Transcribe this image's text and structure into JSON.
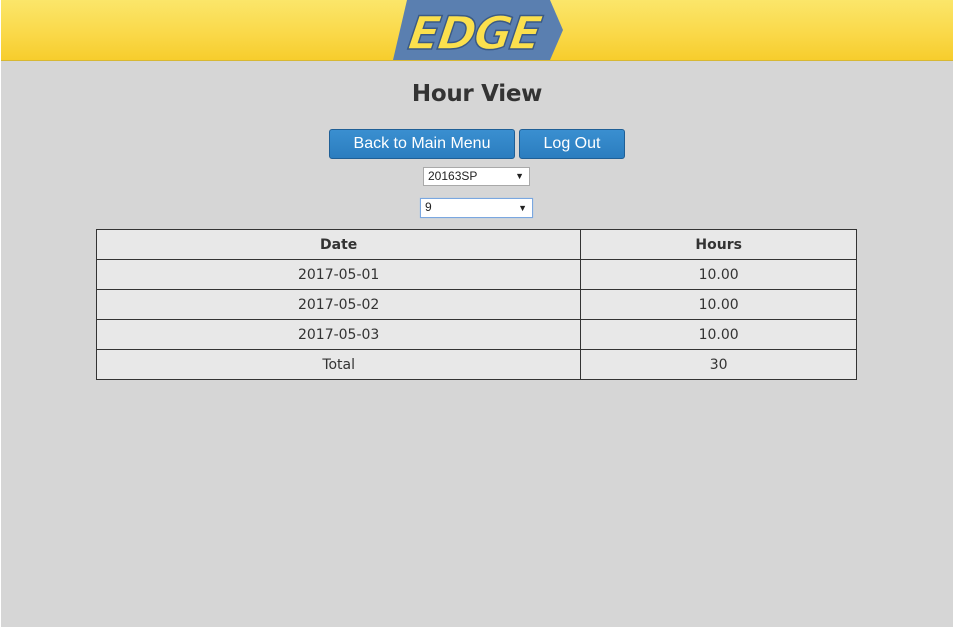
{
  "header": {
    "logo_text": "EDGE",
    "colors": {
      "banner_top": "#fbe66a",
      "banner_bottom": "#f7cd2c",
      "logo_fill": "#5a7fb0"
    }
  },
  "page": {
    "title": "Hour View",
    "background": "#d6d6d6"
  },
  "buttons": {
    "back_label": "Back to Main Menu",
    "logout_label": "Log Out",
    "color": "#2b7dbf"
  },
  "selects": {
    "term_value": "20163SP",
    "number_value": "9"
  },
  "table": {
    "columns": [
      "Date",
      "Hours"
    ],
    "rows": [
      [
        "2017-05-01",
        "10.00"
      ],
      [
        "2017-05-02",
        "10.00"
      ],
      [
        "2017-05-03",
        "10.00"
      ],
      [
        "Total",
        "30"
      ]
    ]
  }
}
